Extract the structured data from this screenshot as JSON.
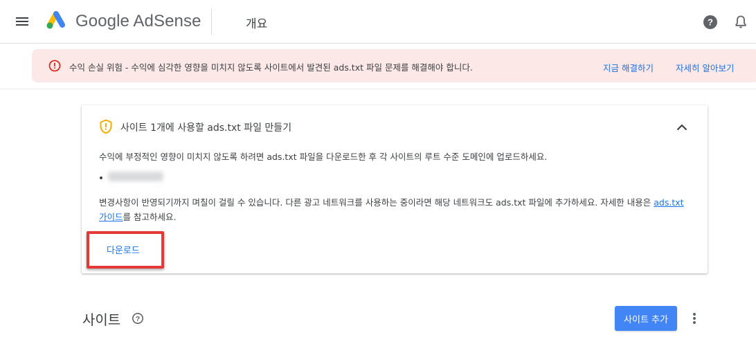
{
  "header": {
    "menu_icon": "hamburger-menu-icon",
    "logo_text": "Google AdSense",
    "page_title": "개요",
    "help_icon": "help-circle-icon",
    "notifications_icon": "bell-icon"
  },
  "alert": {
    "icon": "error-circle-icon",
    "message": "수익 손실 위험 - 수익에 심각한 영향을 미치지 않도록 사이트에서 발견된 ads.txt 파일 문제를 해결해야 합니다.",
    "fix_link": "지금 해결하기",
    "learn_link": "자세히 알아보기",
    "color": "#fce8e6"
  },
  "card": {
    "icon": "shield-warning-icon",
    "title": "사이트 1개에 사용할 ads.txt 파일 만들기",
    "collapse_icon": "chevron-up-icon",
    "description": "수익에 부정적인 영향이 미치지 않도록 하려면 ads.txt 파일을 다운로드한 후 각 사이트의 루트 수준 도메인에 업로드하세요.",
    "note_before": "변경사항이 반영되기까지 며칠이 걸릴 수 있습니다. 다른 광고 네트워크를 사용하는 중이라면 해당 네트워크도 ads.txt 파일에 추가하세요. 자세한 내용은 ",
    "note_link": "ads.txt 가이드",
    "note_after": "를 참고하세요.",
    "download_label": "다운로드"
  },
  "sites": {
    "title": "사이트",
    "help_icon": "help-circle-icon",
    "add_button": "사이트 추가",
    "more_icon": "more-vert-icon"
  },
  "colors": {
    "accent": "#1a73e8",
    "button": "#4285f4",
    "highlight": "#e53935",
    "warning": "#f9ab00",
    "error": "#d93025"
  }
}
